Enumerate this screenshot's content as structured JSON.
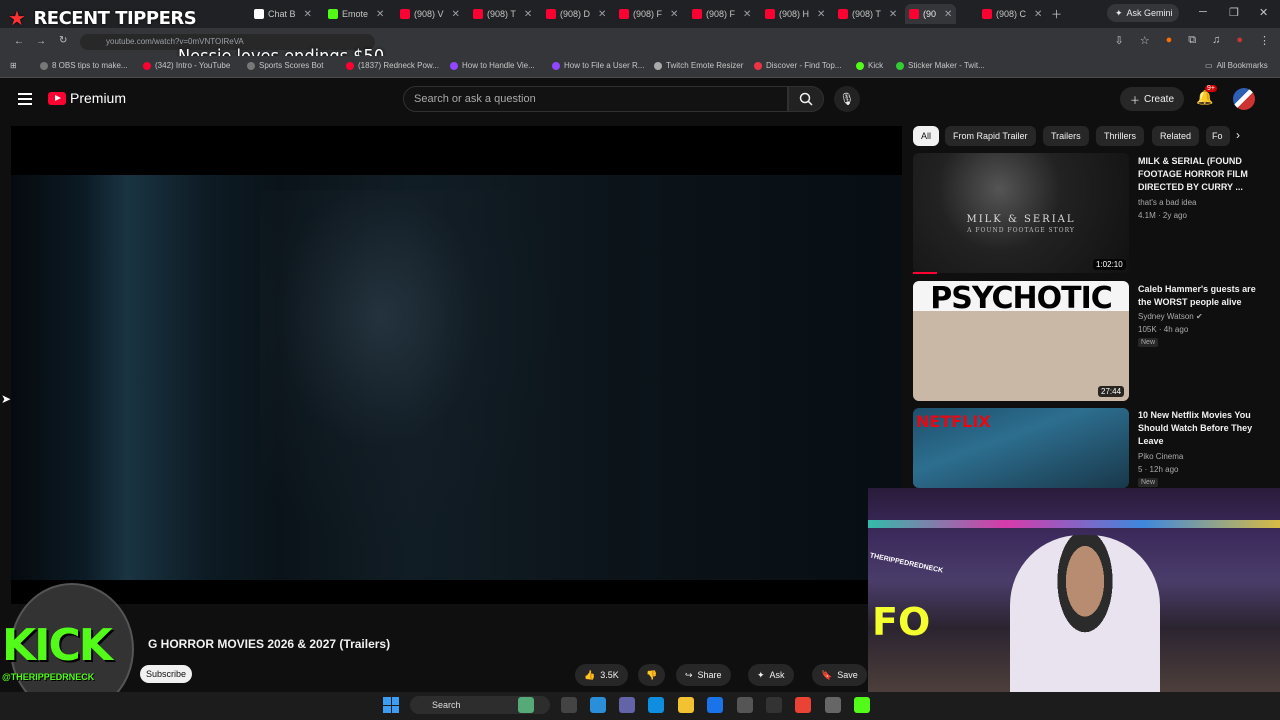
{
  "overlay": {
    "recent_tippers": "RECENT TIPPERS",
    "donation_ticker": "Nessie loves endings $50",
    "kick_logo": "KICK",
    "kick_handle": "@THERIPPEDRNECK"
  },
  "browser": {
    "tabs": [
      {
        "label": "Chat B"
      },
      {
        "label": "Emote"
      },
      {
        "label": "(908) V"
      },
      {
        "label": "(908) T"
      },
      {
        "label": "(908) D"
      },
      {
        "label": "(908) F"
      },
      {
        "label": "(908) F"
      },
      {
        "label": "(908) H"
      },
      {
        "label": "(908) T"
      },
      {
        "label": "(90"
      },
      {
        "label": "(908) C"
      }
    ],
    "ask_gemini": "Ask Gemini",
    "url": "youtube.com/watch?v=0mVNTOIReVA",
    "bookmarks": [
      "8 OBS tips to make...",
      "(342) Intro - YouTube",
      "Sports Scores Bot",
      "(1837) Redneck Pow...",
      "How to Handle Vie...",
      "How to File a User R...",
      "Twitch Emote Resizer",
      "Discover - Find Top...",
      "Kick",
      "Sticker Maker - Twit..."
    ],
    "all_bookmarks": "All Bookmarks"
  },
  "youtube": {
    "logo_text": "Premium",
    "search_placeholder": "Search or ask a question",
    "create_label": "Create",
    "notifications_badge": "9+",
    "video_title": "G HORROR MOVIES 2026 & 2027 (Trailers)",
    "subscribe_label": "Subscribe",
    "actions": {
      "likes": "3.5K",
      "share": "Share",
      "ask": "Ask",
      "save": "Save"
    },
    "chips": [
      "All",
      "From Rapid Trailer",
      "Trailers",
      "Thrillers",
      "Related",
      "Fo"
    ],
    "recommendations": [
      {
        "title": "MILK & SERIAL (FOUND FOOTAGE HORROR FILM DIRECTED BY CURRY ...",
        "channel": "that's a bad idea",
        "meta": "4.1M · 2y ago",
        "duration": "1:02:10",
        "thumb_text": "MILK & SERIAL",
        "thumb_sub": "A FOUND FOOTAGE STORY"
      },
      {
        "title": "Caleb Hammer's guests are the WORST people alive",
        "channel": "Sydney Watson",
        "meta": "105K · 4h ago",
        "badge": "New",
        "duration": "27:44",
        "thumb_text": "PSYCHOTIC"
      },
      {
        "title": "10 New Netflix Movies You Should Watch Before They Leave",
        "channel": "Piko Cinema",
        "meta": "5 · 12h ago",
        "badge": "New",
        "thumb_text": "NETFLIX"
      }
    ]
  },
  "webcam": {
    "sign_text": "FO",
    "name_text": "THERIPPEDREDNECK"
  },
  "taskbar": {
    "search_label": "Search"
  }
}
